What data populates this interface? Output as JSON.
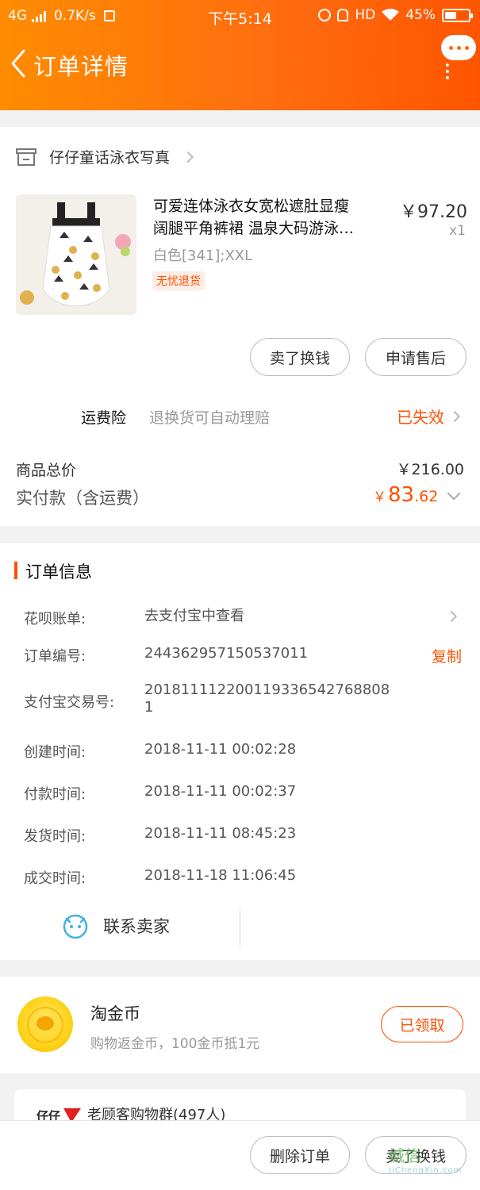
{
  "status_bar": {
    "network": "4G",
    "speed": "0.7K/s",
    "time": "下午5:14",
    "hd": "HD",
    "battery": "45%"
  },
  "nav": {
    "title": "订单详情"
  },
  "shop": {
    "name": "仔仔童话泳衣写真"
  },
  "product": {
    "title_line1": "可爱连体泳衣女宽松遮肚显瘦",
    "title_line2": "阔腿平角裤裙 温泉大码游泳…",
    "sku": "白色[341];XXL",
    "tag": "无忧退货",
    "price": "￥97.20",
    "qty": "x1",
    "btn_sell": "卖了换钱",
    "btn_aftersale": "申请售后"
  },
  "insurance": {
    "label": "运费险",
    "desc": "退换货可自动理赔",
    "status": "已失效"
  },
  "totals": {
    "goods_label": "商品总价",
    "goods_value": "￥216.00",
    "paid_label": "实付款（含运费）",
    "paid_currency": "￥",
    "paid_int": "83",
    "paid_dec": ".62"
  },
  "order_info": {
    "section_title": "订单信息",
    "huabei_label": "花呗账单:",
    "huabei_value": "去支付宝中查看",
    "order_no_label": "订单编号:",
    "order_no_value": "244362957150537011",
    "copy": "复制",
    "alipay_label": "支付宝交易号:",
    "alipay_value": "2018111122001193365427688081",
    "created_label": "创建时间:",
    "created_value": "2018-11-11 00:02:28",
    "paid_time_label": "付款时间:",
    "paid_time_value": "2018-11-11 00:02:37",
    "shipped_label": "发货时间:",
    "shipped_value": "2018-11-11 08:45:23",
    "closed_label": "成交时间:",
    "closed_value": "2018-11-18 11:06:45",
    "contact_seller": "联系卖家"
  },
  "coins": {
    "title": "淘金币",
    "desc": "购物返金币，100金币抵1元",
    "button": "已领取"
  },
  "group": {
    "logo_text": "仔仔",
    "title": "老顾客购物群(497人)"
  },
  "bottom": {
    "delete": "删除订单",
    "sell": "卖了换钱"
  },
  "watermark": {
    "text": "城信",
    "sub": "JiChengXin.com"
  },
  "colors": {
    "accent": "#ff5000",
    "header_start": "#ff8c00",
    "header_end": "#ff5500"
  }
}
